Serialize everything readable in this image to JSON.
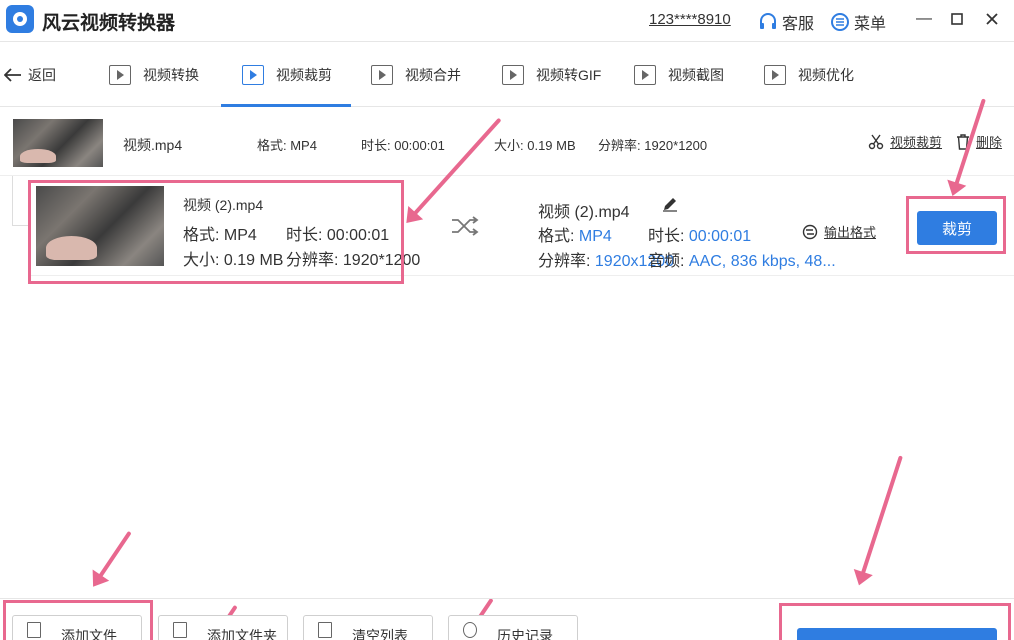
{
  "app": {
    "title": "风云视频转换器",
    "account": "123****8910",
    "service": "客服",
    "menu": "菜单"
  },
  "nav": {
    "back": "返回",
    "tabs": [
      {
        "label": "视频转换",
        "icon": "convert-icon"
      },
      {
        "label": "视频裁剪",
        "icon": "crop-video-icon"
      },
      {
        "label": "视频合并",
        "icon": "merge-icon"
      },
      {
        "label": "视频转GIF",
        "icon": "gif-icon"
      },
      {
        "label": "视频截图",
        "icon": "screenshot-icon"
      },
      {
        "label": "视频优化",
        "icon": "optimize-icon"
      }
    ],
    "active_tab": "视频裁剪"
  },
  "file": {
    "name": "视频.mp4",
    "format": "格式: MP4",
    "duration": "时长: 00:00:01",
    "size": "大小: 0.19 MB",
    "resolution": "分辨率: 1920*1200",
    "crop_link": "视频裁剪",
    "delete_link": "删除"
  },
  "clip": {
    "name": "视频 (2).mp4",
    "format": "格式: MP4",
    "duration": "时长: 00:00:01",
    "size": "大小: 0.19 MB",
    "resolution": "分辨率: 1920*1200"
  },
  "output": {
    "name": "视频 (2).mp4",
    "format_label": "格式:",
    "format_value": "MP4",
    "duration_label": "时长:",
    "duration_value": "00:00:01",
    "resolution_label": "分辨率:",
    "resolution_value": "1920x1200",
    "audio_label": "音频:",
    "audio_value": "AAC, 836 kbps, 48...",
    "format_link": "输出格式",
    "crop_button": "裁剪"
  },
  "bottom": {
    "add_file": "添加文件",
    "add_folder": "添加文件夹",
    "clear_list": "清空列表",
    "history": "历史记录"
  },
  "colors": {
    "accent": "#2f7de1",
    "annotation": "#e8688f"
  }
}
